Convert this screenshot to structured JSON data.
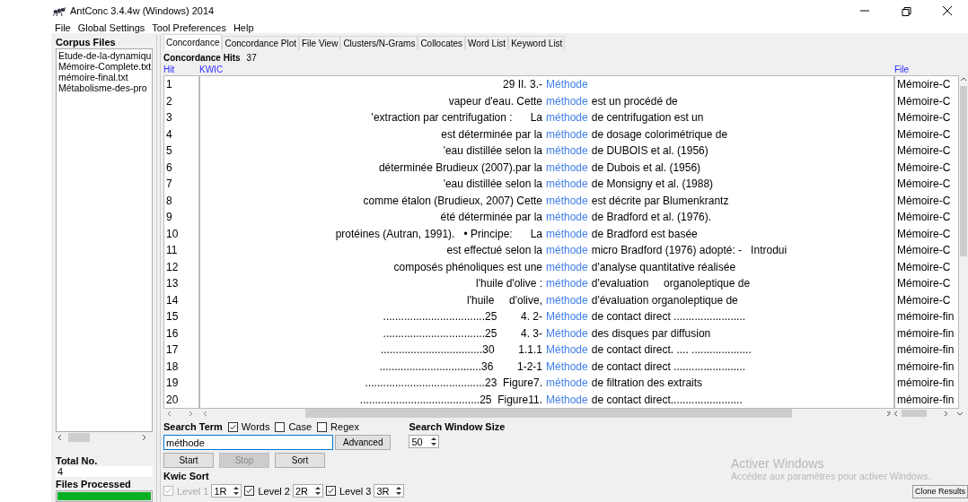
{
  "window": {
    "title": "AntConc 3.4.4w (Windows) 2014"
  },
  "menu": [
    "File",
    "Global Settings",
    "Tool Preferences",
    "Help"
  ],
  "corpus_files": {
    "title": "Corpus Files",
    "files": [
      "Etude-de-la-dynamiqu",
      "Mémoire-Complete.txt",
      "mémoire-final.txt",
      "Métabolisme-des-pro"
    ]
  },
  "total": {
    "label": "Total No.",
    "value": "4"
  },
  "files_processed": {
    "label": "Files Processed",
    "level": 1
  },
  "tabs": [
    {
      "label": "Concordance",
      "selected": true
    },
    {
      "label": "Concordance Plot",
      "selected": false
    },
    {
      "label": "File View",
      "selected": false
    },
    {
      "label": "Clusters/N-Grams",
      "selected": false
    },
    {
      "label": "Collocates",
      "selected": false
    },
    {
      "label": "Word List",
      "selected": false
    },
    {
      "label": "Keyword List",
      "selected": false
    }
  ],
  "hits": {
    "label": "Concordance Hits",
    "value": "37"
  },
  "columns": [
    "Hit",
    "KWIC",
    "File"
  ],
  "rows": [
    {
      "hit": "1",
      "left": "29 II. 3.-",
      "keyword": "Méthode",
      "right": "",
      "file": "Mémoire-C"
    },
    {
      "hit": "2",
      "left": "vapeur d'eau. Cette",
      "keyword": "méthode",
      "right": "est un procédé de",
      "file": "Mémoire-C"
    },
    {
      "hit": "3",
      "left": "'extraction par centrifugation :      La",
      "keyword": "méthode",
      "right": "de centrifugation est un",
      "file": "Mémoire-C"
    },
    {
      "hit": "4",
      "left": "est déterminée par la",
      "keyword": "méthode",
      "right": "de dosage colorimétrique de",
      "file": "Mémoire-C"
    },
    {
      "hit": "5",
      "left": "'eau distillée selon la",
      "keyword": "méthode",
      "right": "de DUBOIS et al. (1956)",
      "file": "Mémoire-C"
    },
    {
      "hit": "6",
      "left": "déterminée Brudieux (2007).par la",
      "keyword": "méthode",
      "right": "de Dubois et al. (1956)",
      "file": "Mémoire-C"
    },
    {
      "hit": "7",
      "left": "'eau distillée selon la",
      "keyword": "méthode",
      "right": "de Monsigny et al. (1988)",
      "file": "Mémoire-C"
    },
    {
      "hit": "8",
      "left": "comme étalon (Brudieux, 2007) Cette",
      "keyword": "méthode",
      "right": "est décrite par Blumenkrantz",
      "file": "Mémoire-C"
    },
    {
      "hit": "9",
      "left": "été déterminée par la",
      "keyword": "méthode",
      "right": "de Bradford et al. (1976).",
      "file": "Mémoire-C"
    },
    {
      "hit": "10",
      "left": "protéines (Autran, 1991).   • Principe:      La",
      "keyword": "méthode",
      "right": "de Bradford est basée",
      "file": "Mémoire-C"
    },
    {
      "hit": "11",
      "left": "est effectué selon la",
      "keyword": "méthode",
      "right": "micro Bradford (1976) adopté: -   Introdui",
      "file": "Mémoire-C"
    },
    {
      "hit": "12",
      "left": "composés phénoliques est une",
      "keyword": "méthode",
      "right": "d'analyse quantitative réalisée",
      "file": "Mémoire-C"
    },
    {
      "hit": "13",
      "left": "l'huile d'olive :",
      "keyword": "méthode",
      "right": "d'evaluation     organoleptique de",
      "file": "Mémoire-C"
    },
    {
      "hit": "14",
      "left": "l'huile     d'olive,",
      "keyword": "méthode",
      "right": "d'évaluation organoleptique de",
      "file": "Mémoire-C"
    },
    {
      "hit": "15",
      "left": "..................................25        4. 2-",
      "keyword": "Méthode",
      "right": "de contact direct ........................",
      "file": "mémoire-fin"
    },
    {
      "hit": "16",
      "left": "..................................25        4. 3-",
      "keyword": "Méthode",
      "right": "des disques par diffusion",
      "file": "mémoire-fin"
    },
    {
      "hit": "17",
      "left": "..................................30        1.1.1",
      "keyword": "Méthode",
      "right": "de contact direct. .... ....................",
      "file": "mémoire-fin"
    },
    {
      "hit": "18",
      "left": "..................................36        1-2-1",
      "keyword": "Méthode",
      "right": "de contact direct ........................",
      "file": "mémoire-fin"
    },
    {
      "hit": "19",
      "left": "........................................23  Figure7.",
      "keyword": "méthode",
      "right": "de filtration des extraits",
      "file": "mémoire-fin"
    },
    {
      "hit": "20",
      "left": "........................................25  Figure11.",
      "keyword": "Méthode",
      "right": "de contact direct........................",
      "file": "mémoire-fin"
    }
  ],
  "search": {
    "label": "Search Term",
    "options": [
      {
        "label": "Words",
        "checked": true
      },
      {
        "label": "Case",
        "checked": false
      },
      {
        "label": "Regex",
        "checked": false
      }
    ],
    "value": "méthode",
    "advanced": "Advanced"
  },
  "window_size": {
    "label": "Search Window Size",
    "value": "50"
  },
  "buttons": [
    {
      "label": "Start",
      "disabled": false
    },
    {
      "label": "Stop",
      "disabled": true
    },
    {
      "label": "Sort",
      "disabled": false
    }
  ],
  "kwic_sort": {
    "label": "Kwic Sort",
    "levels": [
      {
        "label": "Level 1",
        "checked": true,
        "disabled": true,
        "value": "1R"
      },
      {
        "label": "Level 2",
        "checked": true,
        "disabled": false,
        "value": "2R"
      },
      {
        "label": "Level 3",
        "checked": true,
        "disabled": false,
        "value": "3R"
      }
    ]
  },
  "activation_notice": {
    "title": "Activer Windows",
    "text": "Accédez aux paramètres pour activer Windows."
  },
  "clone_button": "Clone Results"
}
